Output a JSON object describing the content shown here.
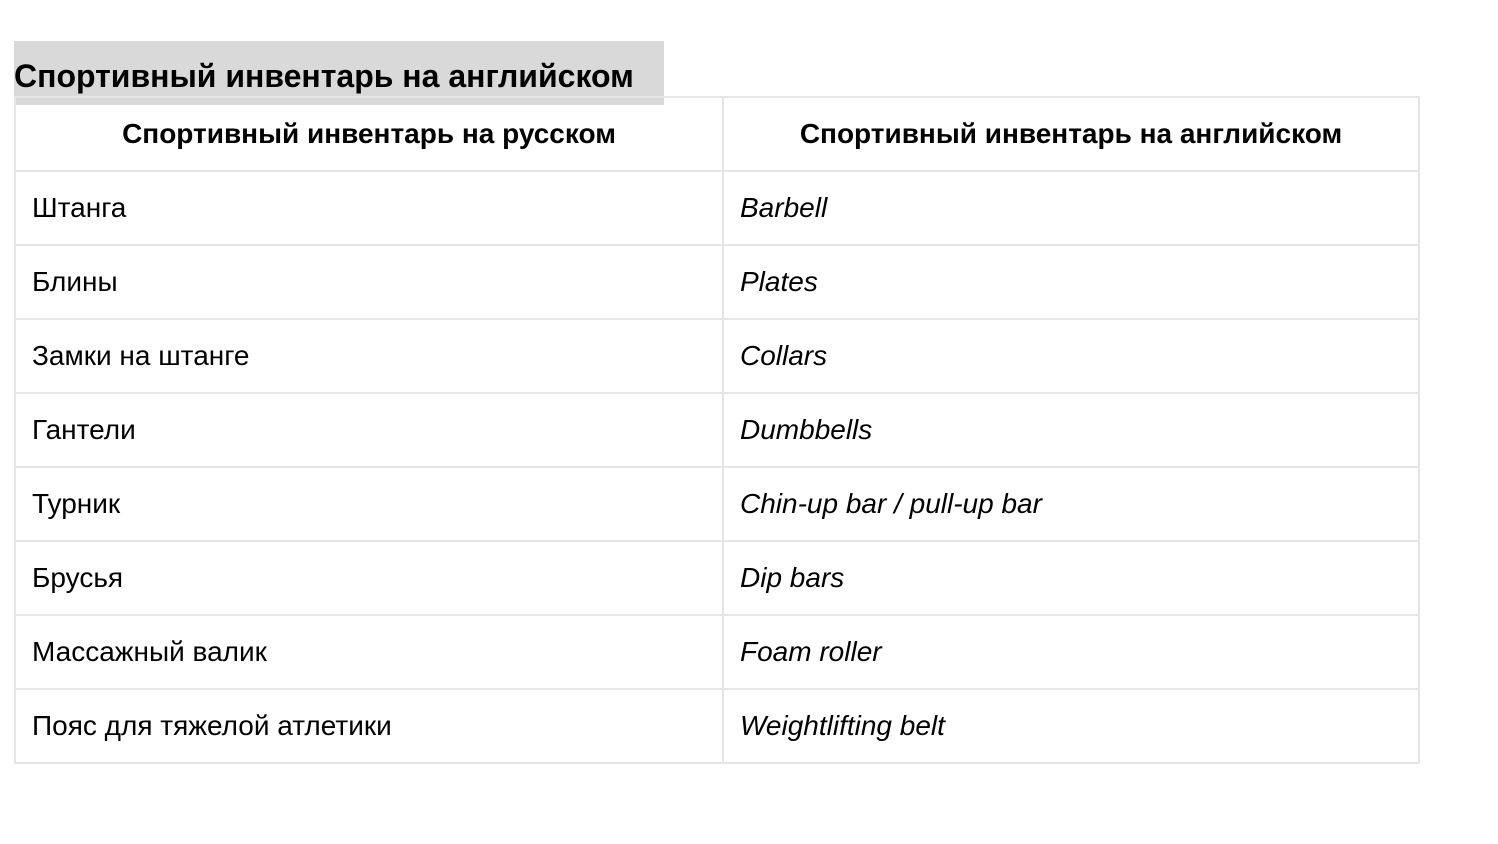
{
  "heading": "Спортивный инвентарь на английском",
  "table": {
    "headers": [
      "Спортивный инвентарь на русском",
      "Спортивный инвентарь на английском"
    ],
    "rows": [
      {
        "ru": "Штанга",
        "en": "Barbell"
      },
      {
        "ru": "Блины",
        "en": "Plates"
      },
      {
        "ru": "Замки на штанге",
        "en": "Collars"
      },
      {
        "ru": "Гантели",
        "en": "Dumbbells"
      },
      {
        "ru": "Турник",
        "en": "Chin-up bar / pull-up bar"
      },
      {
        "ru": "Брусья",
        "en": "Dip bars"
      },
      {
        "ru": "Массажный валик",
        "en": "Foam roller"
      },
      {
        "ru": "Пояс для тяжелой атлетики",
        "en": "Weightlifting belt"
      }
    ]
  },
  "colors": {
    "heading_background": "#d9d9d9",
    "table_border": "#e5e5e5",
    "text": "#000000"
  }
}
